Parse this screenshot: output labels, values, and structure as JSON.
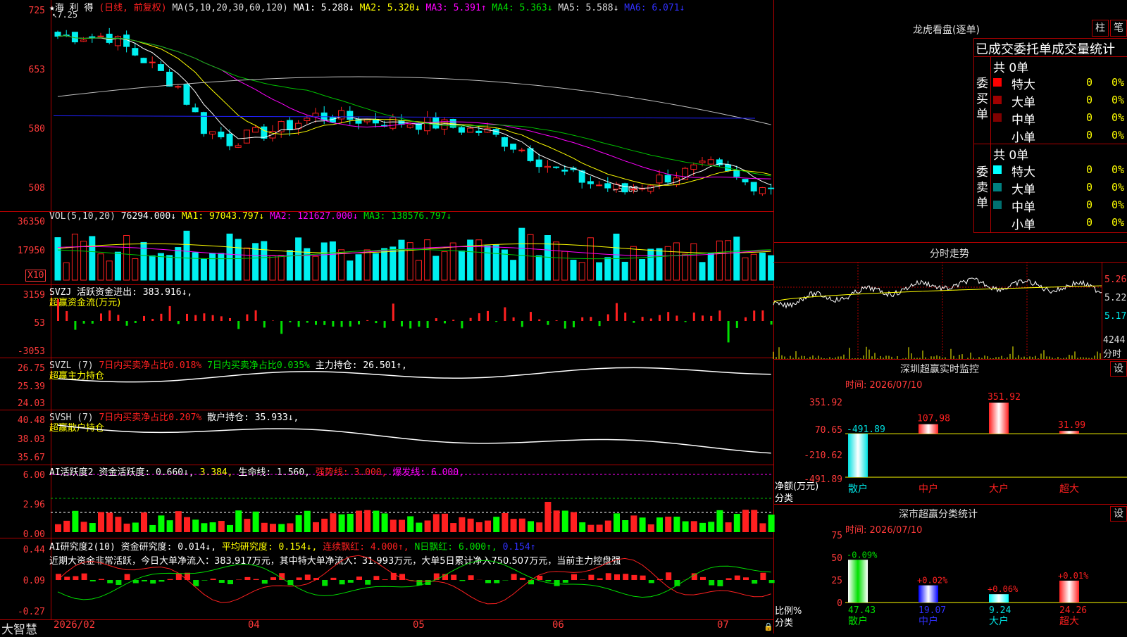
{
  "colors": {
    "up": "#ff2020",
    "down": "#00f0f0",
    "grid": "#b00000",
    "ma1": "#ffffff",
    "ma2": "#ffff00",
    "ma3": "#ff00ff",
    "ma4": "#00c000",
    "ma5": "#c0c0c0",
    "ma6": "#2020ff"
  },
  "main": {
    "stock_name": "★海 利 得",
    "period": "(日线, 前复权)",
    "ma_params": "MA(5,10,20,30,60,120)",
    "ma1": "MA1: 5.288↓",
    "ma2": "MA2: 5.320↓",
    "ma3": "MA3: 5.391↑",
    "ma4": "MA4: 5.363↓",
    "ma5": "MA5: 5.588↓",
    "ma6": "MA6: 6.071↓",
    "high_mark": "7.25",
    "low_mark": "←5.08",
    "y_labels": [
      "725",
      "653",
      "580",
      "508"
    ]
  },
  "vol": {
    "header_name": "VOL(5,10,20)",
    "value": "76294.000↓",
    "ma1": "MA1: 97043.797↓",
    "ma2": "MA2: 121627.000↓",
    "ma3": "MA3: 138576.797↓",
    "y_labels": [
      "36350",
      "17950"
    ],
    "unit": "X10"
  },
  "svzj": {
    "header": "SVZJ  活跃资金进出: 383.916↓,",
    "sub": "超赢资金流(万元)",
    "y_labels": [
      "3159",
      "53",
      "-3053"
    ]
  },
  "svzl": {
    "name": "SVZL (7)",
    "t1": "7日内买卖净占比0.018%",
    "t2": "7日内买卖净占比0.035%",
    "t3": "主力持仓: 26.501↑,",
    "sub": "超赢主力持仓",
    "y_labels": [
      "26.75",
      "25.39",
      "24.03"
    ]
  },
  "svsh": {
    "name": "SVSH (7)",
    "t1": "7日内买卖净占比0.207%",
    "t2": "散户持仓: 35.933↓,",
    "sub": "超赢散户持仓",
    "y_labels": [
      "40.48",
      "38.03",
      "35.67"
    ]
  },
  "ai1": {
    "name": "AI活跃度2",
    "t1": "资金活跃度: 0.660↓,",
    "t2": "3.384,",
    "t3": "生命线: 1.560,",
    "t4": "强势线: 3.000,",
    "t5": "爆发线: 6.000,",
    "y_labels": [
      "6.00",
      "2.96",
      "0.00"
    ]
  },
  "ai2": {
    "name": "AI研究度2(10)",
    "t1": "资金研究度: 0.014↓,",
    "t2": "平均研究度: 0.154↓,",
    "t3": "连续飘红: 4.000↑,",
    "t4": "N日飘红: 6.000↑,",
    "t5": "0.154↑",
    "summary": "近期大资金非常活跃，今日大单净流入：383.917万元，其中特大单净流入：31.993万元，大单5日累计净入750.507万元，当前主力控盘强",
    "y_labels": [
      "0.44",
      "0.09",
      "-0.27"
    ]
  },
  "bottom": {
    "brand": "大智慧",
    "dates": [
      "2026/02",
      "04",
      "05",
      "06",
      "07"
    ]
  },
  "lhb": {
    "title": "龙虎看盘(逐单)",
    "btn1": "柱",
    "btn2": "笔",
    "subtitle": "已成交委托单成交量统计",
    "buy_label": "委买单",
    "sell_label": "委卖单",
    "buy_total": "共 0单",
    "sell_total": "共 0单",
    "buy_rows": [
      {
        "label": "特大",
        "n": "0",
        "p": "0%",
        "color": "#ff0000"
      },
      {
        "label": "大单",
        "n": "0",
        "p": "0%",
        "color": "#a00000"
      },
      {
        "label": "中单",
        "n": "0",
        "p": "0%",
        "color": "#800000"
      },
      {
        "label": "小单",
        "n": "0",
        "p": "0%",
        "color": "#000000"
      }
    ],
    "sell_rows": [
      {
        "label": "特大",
        "n": "0",
        "p": "0%",
        "color": "#00ffff"
      },
      {
        "label": "大单",
        "n": "0",
        "p": "0%",
        "color": "#008080"
      },
      {
        "label": "中单",
        "n": "0",
        "p": "0%",
        "color": "#007070"
      },
      {
        "label": "小单",
        "n": "0",
        "p": "0%",
        "color": "#000000"
      }
    ]
  },
  "fenshi": {
    "title": "分时走势",
    "prices": [
      "5.26",
      "5.22",
      "5.17"
    ],
    "vol": "4244",
    "vol_label": "分时"
  },
  "monitor": {
    "title": "深圳超赢实时监控",
    "set": "设",
    "time": "时间: 2026/07/10",
    "y_labels": [
      "351.92",
      "70.65",
      "-210.62",
      "-491.89"
    ],
    "y_unit": "净额(万元)",
    "x_unit": "分类",
    "categories": [
      "散户",
      "中户",
      "大户",
      "超大"
    ],
    "values": [
      -491.89,
      107.98,
      351.92,
      31.99
    ],
    "value_labels": [
      "-491.89",
      "107.98",
      "351.92",
      "31.99"
    ]
  },
  "classify": {
    "title": "深市超赢分类统计",
    "set": "设",
    "time": "时间: 2026/07/10",
    "y_labels": [
      "75",
      "50",
      "25",
      "0"
    ],
    "y_unit": "比例%",
    "x_unit": "分类",
    "categories": [
      "散户",
      "中户",
      "大户",
      "超大"
    ],
    "values": [
      47.43,
      19.07,
      9.24,
      24.26
    ],
    "changes": [
      "-0.09%",
      "+0.02%",
      "+0.06%",
      "+0.01%"
    ]
  }
}
